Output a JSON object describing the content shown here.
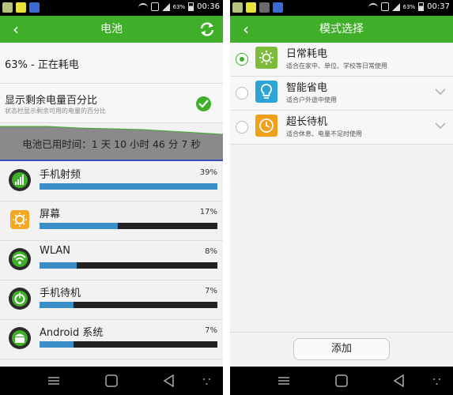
{
  "left_screen": {
    "statusbar": {
      "battery_pct": "63%",
      "time": "00:36"
    },
    "titlebar": {
      "back": "‹",
      "title": "电池"
    },
    "status": {
      "text": "63% - 正在耗电"
    },
    "toggle": {
      "title": "显示剩余电量百分比",
      "desc": "状态栏显示剩余可用的电量的百分比",
      "checked": true
    },
    "usage_text": "电池已用时间：1 天 10 小时 46 分 7 秒",
    "apps": [
      {
        "name": "手机射频",
        "pct_label": "39%",
        "value": 1.0,
        "icon": "signal-icon"
      },
      {
        "name": "屏幕",
        "pct_label": "17%",
        "value": 0.44,
        "icon": "brightness-icon"
      },
      {
        "name": "WLAN",
        "pct_label": "8%",
        "value": 0.21,
        "icon": "wifi-icon"
      },
      {
        "name": "手机待机",
        "pct_label": "7%",
        "value": 0.19,
        "icon": "power-icon"
      },
      {
        "name": "Android 系统",
        "pct_label": "7%",
        "value": 0.19,
        "icon": "android-icon"
      }
    ]
  },
  "right_screen": {
    "statusbar": {
      "battery_pct": "63%",
      "time": "00:37"
    },
    "titlebar": {
      "back": "‹",
      "title": "模式选择"
    },
    "modes": [
      {
        "name": "日常耗电",
        "desc": "适合在家中、单位、学校等日常使用",
        "selected": true,
        "icon": "sun-icon",
        "color": "#7dbb3a"
      },
      {
        "name": "智能省电",
        "desc": "适合户外途中使用",
        "selected": false,
        "icon": "bulb-icon",
        "color": "#2ea3d6"
      },
      {
        "name": "超长待机",
        "desc": "适合休息、电量不足时使用",
        "selected": false,
        "icon": "clock-icon",
        "color": "#f0a019"
      }
    ],
    "add_button": "添加"
  },
  "colors": {
    "accent": "#3fae29",
    "bar": "#3a8fc9"
  }
}
